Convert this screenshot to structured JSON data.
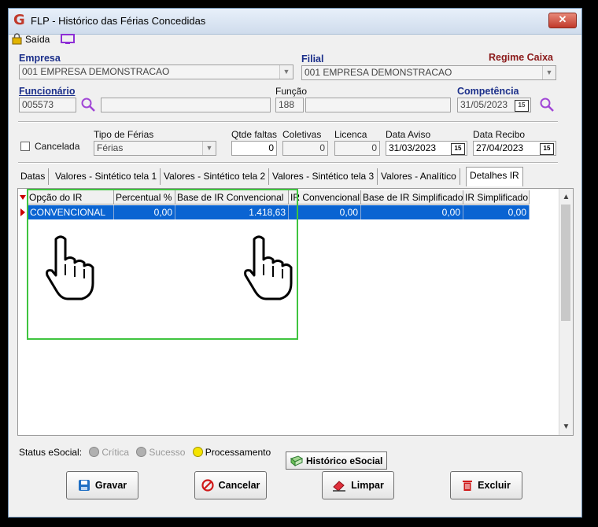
{
  "window": {
    "title": "FLP - Histórico das Férias Concedidas",
    "close_label": "✕"
  },
  "toolbar": {
    "exit_label": "Saída"
  },
  "empresa": {
    "label": "Empresa",
    "value": "001 EMPRESA DEMONSTRACAO"
  },
  "filial": {
    "label": "Filial",
    "value": "001 EMPRESA DEMONSTRACAO"
  },
  "regime": {
    "label": "Regime Caixa"
  },
  "funcionario": {
    "label": "Funcionário",
    "code": "005573",
    "name": ""
  },
  "funcao": {
    "label": "Função",
    "code": "188",
    "name": ""
  },
  "competencia": {
    "label": "Competência",
    "value": "31/05/2023"
  },
  "cancelada": {
    "label": "Cancelada",
    "checked": false
  },
  "tipo_ferias": {
    "label": "Tipo de Férias",
    "value": "Férias"
  },
  "qtde_faltas": {
    "label": "Qtde faltas",
    "value": "0"
  },
  "coletivas": {
    "label": "Coletivas",
    "value": "0"
  },
  "licenca": {
    "label": "Licenca",
    "value": "0"
  },
  "data_aviso": {
    "label": "Data Aviso",
    "value": "31/03/2023"
  },
  "data_recibo": {
    "label": "Data Recibo",
    "value": "27/04/2023"
  },
  "calendar_icon_text": "15",
  "tabs": [
    {
      "label": "Datas",
      "active": false
    },
    {
      "label": "Valores - Sintético tela 1",
      "active": false
    },
    {
      "label": "Valores - Sintético tela 2",
      "active": false
    },
    {
      "label": "Valores - Sintético tela 3",
      "active": false
    },
    {
      "label": "Valores - Analítico",
      "active": false
    },
    {
      "label": "Detalhes IR",
      "active": true
    }
  ],
  "grid": {
    "columns": [
      "Opção do IR",
      "Percentual %",
      "Base de IR Convencional",
      "IR Convencional",
      "Base de IR Simplificado",
      "IR Simplificado"
    ],
    "rows": [
      [
        "CONVENCIONAL",
        "0,00",
        "1.418,63",
        "0,00",
        "0,00",
        "0,00"
      ]
    ]
  },
  "status": {
    "label": "Status eSocial:",
    "items": [
      {
        "label": "Crítica",
        "color": "#b0b0b0",
        "active": false
      },
      {
        "label": "Sucesso",
        "color": "#b0b0b0",
        "active": false
      },
      {
        "label": "Processamento",
        "color": "#f5e400",
        "active": true
      }
    ],
    "history_button": "Histórico eSocial"
  },
  "buttons": {
    "save": "Gravar",
    "cancel": "Cancelar",
    "clear": "Limpar",
    "delete": "Excluir"
  },
  "colors": {
    "selection": "#0a64d2",
    "highlight": "#3fc43f",
    "label_blue": "#1b2f8a",
    "label_red": "#8b1a1a"
  }
}
